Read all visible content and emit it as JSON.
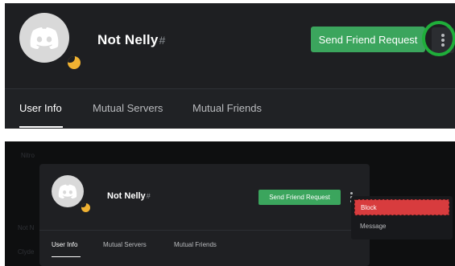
{
  "top": {
    "username": "Not Nelly",
    "hash": "#",
    "send_friend_request": "Send Friend Request",
    "tabs": [
      {
        "label": "User Info",
        "active": true
      },
      {
        "label": "Mutual Servers",
        "active": false
      },
      {
        "label": "Mutual Friends",
        "active": false
      }
    ],
    "status_color": "#f0b232",
    "highlight_color": "#1fae3a",
    "more_icon": "vertical-dots-icon"
  },
  "bottom": {
    "username": "Not Nelly",
    "hash": "#",
    "send_friend_request": "Send Friend Request",
    "tabs": [
      {
        "label": "User Info",
        "active": true
      },
      {
        "label": "Mutual Servers",
        "active": false
      },
      {
        "label": "Mutual Friends",
        "active": false
      }
    ],
    "menu": {
      "block": "Block",
      "message": "Message"
    },
    "block_color": "#d83c3e",
    "background_fragments": [
      "Nitro",
      "Not N",
      "Clyde"
    ]
  },
  "colors": {
    "accent_green": "#3ba55d",
    "panel_bg": "#1e1f22"
  }
}
